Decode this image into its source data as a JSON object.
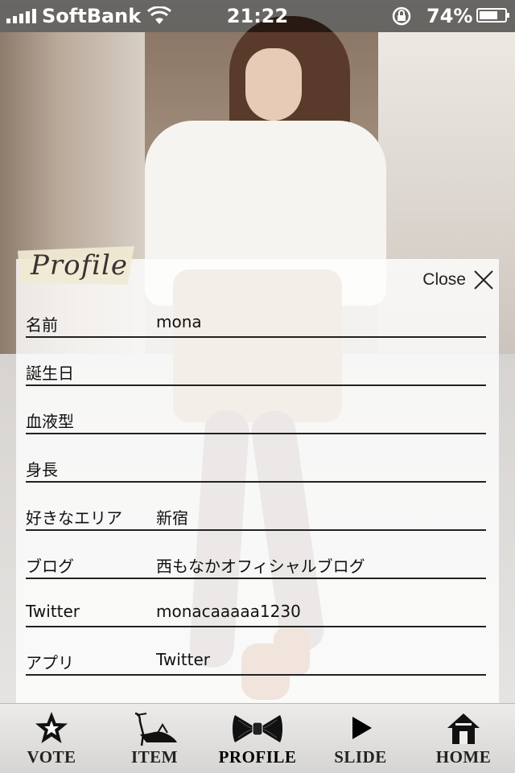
{
  "status_bar": {
    "carrier": "SoftBank",
    "time": "21:22",
    "battery_text": "74%",
    "battery_level": 0.74,
    "icons": [
      "signal-icon",
      "wifi-icon",
      "rotation-lock-icon",
      "battery-icon"
    ]
  },
  "profile": {
    "tab_label": "Profile",
    "close_label": "Close",
    "rows": [
      {
        "label": "名前",
        "value": "mona"
      },
      {
        "label": "誕生日",
        "value": ""
      },
      {
        "label": "血液型",
        "value": ""
      },
      {
        "label": "身長",
        "value": ""
      },
      {
        "label": "好きなエリア",
        "value": "新宿"
      },
      {
        "label": "ブログ",
        "value": "西もなかオフィシャルブログ"
      },
      {
        "label": "Twitter",
        "value": "monacaaaaa1230"
      },
      {
        "label": "アプリ",
        "value": "Twitter"
      }
    ]
  },
  "tabbar": {
    "items": [
      {
        "label": "VOTE",
        "icon": "star-icon"
      },
      {
        "label": "ITEM",
        "icon": "high-heel-icon"
      },
      {
        "label": "PROFILE",
        "icon": "bow-icon"
      },
      {
        "label": "SLIDE",
        "icon": "play-icon"
      },
      {
        "label": "HOME",
        "icon": "house-icon"
      }
    ],
    "active": "PROFILE"
  },
  "colors": {
    "panel_bg": "#ffffff",
    "text": "#111111",
    "tab_label_bg": "#f0e9d4",
    "status_bg": "#000000"
  }
}
